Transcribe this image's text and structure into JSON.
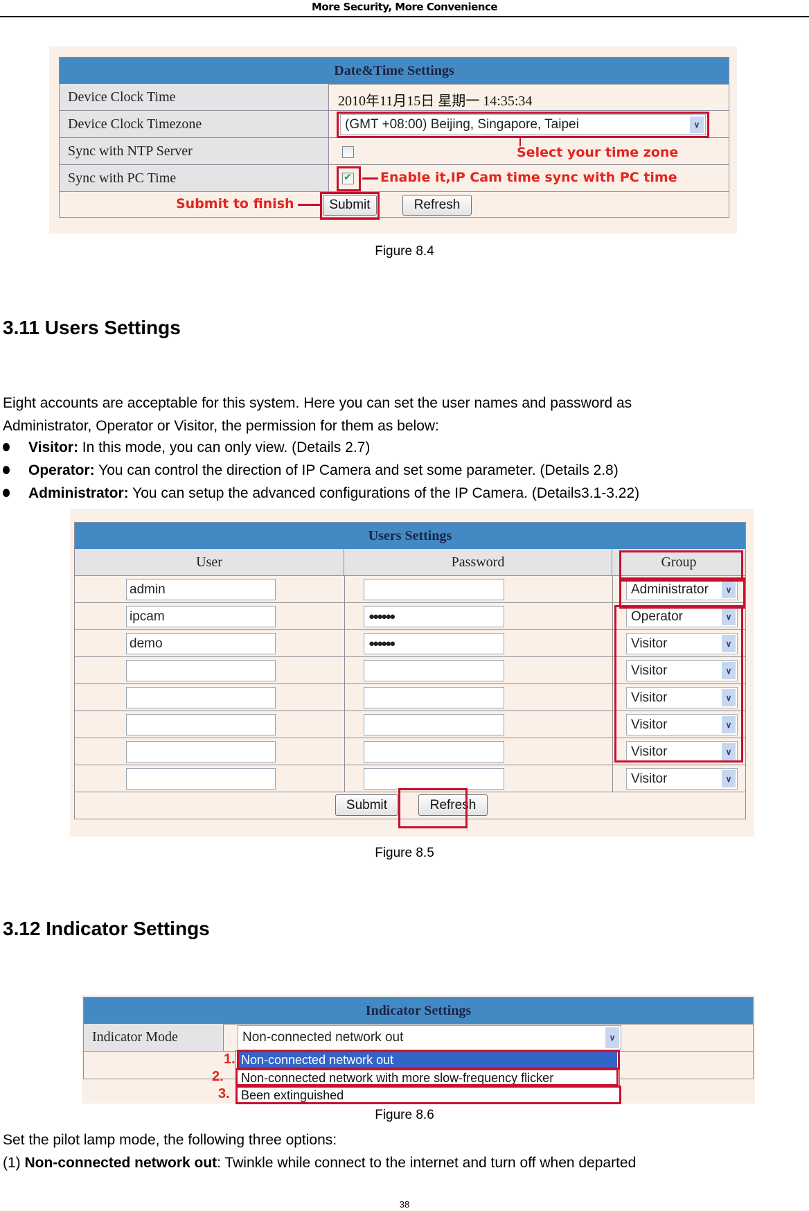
{
  "page_header": "More Security, More Convenience",
  "page_number": "38",
  "figure_8_4": {
    "caption": "Figure 8.4",
    "panel_title": "Date&Time Settings",
    "rows": [
      {
        "label": "Device Clock Time",
        "value": "2010年11月15日  星期一  14:35:34"
      },
      {
        "label": "Device Clock Timezone",
        "value": "(GMT +08:00) Beijing, Singapore, Taipei"
      },
      {
        "label": "Sync with NTP Server",
        "checked": false
      },
      {
        "label": "Sync with PC Time",
        "checked": true
      }
    ],
    "submit_label": "Submit",
    "refresh_label": "Refresh",
    "annotations": {
      "timezone": "Select your time zone",
      "sync_pc": "Enable it,IP Cam time sync with PC time",
      "submit": "Submit to finish"
    }
  },
  "section_3_11": {
    "heading": "3.11 Users Settings",
    "paragraph_line1": "Eight accounts are acceptable for this system. Here you can set the user names and password as",
    "paragraph_line2": "Administrator, Operator or Visitor, the permission for them as below:",
    "bullets": [
      {
        "term": "Visitor:",
        "text": " In this mode, you can only view. (Details 2.7)"
      },
      {
        "term": "Operator:",
        "text": " You can control the direction of IP Camera and set some parameter. (Details 2.8)"
      },
      {
        "term": "Administrator:",
        "text": " You can setup the advanced configurations of the IP Camera. (Details3.1-3.22)"
      }
    ]
  },
  "figure_8_5": {
    "caption": "Figure 8.5",
    "panel_title": "Users Settings",
    "columns": [
      "User",
      "Password",
      "Group"
    ],
    "users": [
      {
        "user": "admin",
        "password": "",
        "group": "Administrator"
      },
      {
        "user": "ipcam",
        "password": "●●●●●●",
        "group": "Operator"
      },
      {
        "user": "demo",
        "password": "●●●●●●",
        "group": "Visitor"
      },
      {
        "user": "",
        "password": "",
        "group": "Visitor"
      },
      {
        "user": "",
        "password": "",
        "group": "Visitor"
      },
      {
        "user": "",
        "password": "",
        "group": "Visitor"
      },
      {
        "user": "",
        "password": "",
        "group": "Visitor"
      },
      {
        "user": "",
        "password": "",
        "group": "Visitor"
      }
    ],
    "submit_label": "Submit",
    "refresh_label": "Refresh"
  },
  "section_3_12": {
    "heading": "3.12 Indicator Settings"
  },
  "figure_8_6": {
    "caption": "Figure 8.6",
    "panel_title": "Indicator Settings",
    "mode_label": "Indicator Mode",
    "selected": "Non-connected network out",
    "options": [
      {
        "num": "1.",
        "label": "Non-connected network out"
      },
      {
        "num": "2.",
        "label": "Non-connected network with more slow-frequency flicker"
      },
      {
        "num": "3.",
        "label": "Been extinguished"
      }
    ]
  },
  "closing": {
    "line1": "Set the pilot lamp mode, the following three options:",
    "line2_prefix": "(1) ",
    "line2_term": "Non-connected network out",
    "line2_text": ": Twinkle while connect to the internet and turn off when departed"
  },
  "colors": {
    "annotation_red": "#e2261f",
    "panel_blue": "#438ac4",
    "panel_bg": "#faf0e8"
  }
}
